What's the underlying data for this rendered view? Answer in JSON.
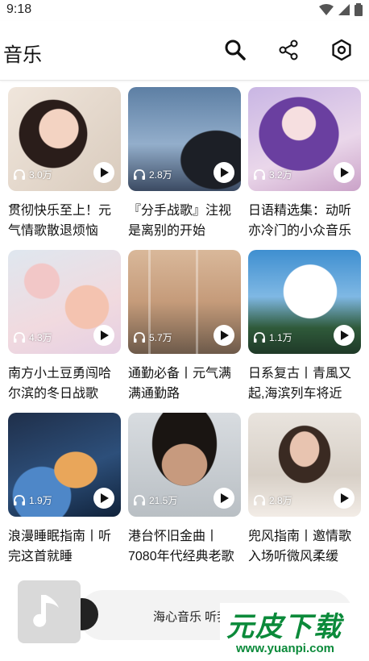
{
  "status": {
    "time": "9:18"
  },
  "app": {
    "title": "音乐"
  },
  "cards": [
    {
      "count": "3.0万",
      "title_l1": "贯彻快乐至上！元",
      "title_l2": "气情歌散退烦恼"
    },
    {
      "count": "2.8万",
      "title_l1": "『分手战歌』注视",
      "title_l2": "是离别的开始"
    },
    {
      "count": "3.2万",
      "title_l1": "日语精选集：动听",
      "title_l2": "亦冷门的小众音乐"
    },
    {
      "count": "4.3万",
      "title_l1": "南方小土豆勇闯哈",
      "title_l2": "尔滨的冬日战歌"
    },
    {
      "count": "5.7万",
      "title_l1": "通勤必备丨元气满",
      "title_l2": "满通勤路"
    },
    {
      "count": "1.1万",
      "title_l1": "日系复古丨青風又",
      "title_l2": "起,海滨列车将近"
    },
    {
      "count": "1.9万",
      "title_l1": "浪漫睡眠指南丨听",
      "title_l2": "完这首就睡"
    },
    {
      "count": "21.5万",
      "title_l1": "港台怀旧金曲丨",
      "title_l2": "7080年代经典老歌"
    },
    {
      "count": "2.8万",
      "title_l1": "兜风指南丨邀情歌",
      "title_l2": "入场听微风柔缓"
    }
  ],
  "player": {
    "text": "海心音乐 听我想听"
  },
  "watermark": {
    "big": "元皮下载",
    "small": "www.yuanpi.com"
  }
}
